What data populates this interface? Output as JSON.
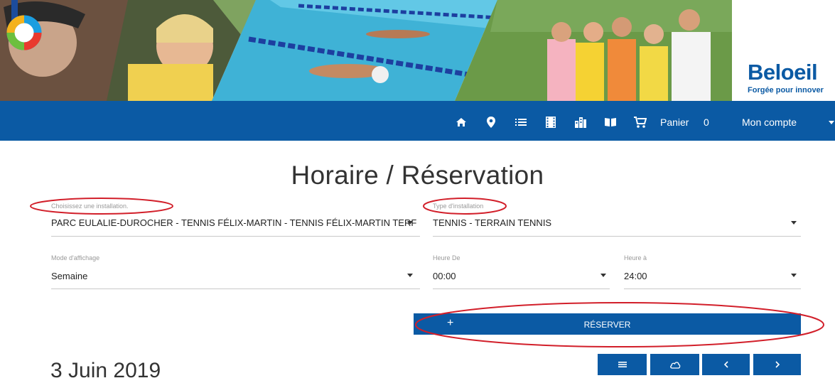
{
  "brand": {
    "name": "Beloeil",
    "tagline": "Forgée pour innover"
  },
  "nav": {
    "cart_label": "Panier",
    "cart_count": "0",
    "account_label": "Mon compte",
    "icons": [
      "home-icon",
      "map-pin-icon",
      "list-icon",
      "film-icon",
      "buildings-icon",
      "book-open-icon",
      "cart-icon"
    ]
  },
  "page": {
    "title": "Horaire / Réservation"
  },
  "form": {
    "installation": {
      "label": "Choisissez une installation.",
      "value": "PARC EULALIE-DUROCHER - TENNIS FÉLIX-MARTIN - TENNIS FÉLIX-MARTIN TERF"
    },
    "type": {
      "label": "Type d'installation",
      "value": "TENNIS - TERRAIN TENNIS"
    },
    "display_mode": {
      "label": "Mode d'affichage",
      "value": "Semaine"
    },
    "hour_from": {
      "label": "Heure De",
      "value": "00:00"
    },
    "hour_to": {
      "label": "Heure à",
      "value": "24:00"
    }
  },
  "reserve": {
    "plus": "+",
    "label": "RÉSERVER"
  },
  "calendar": {
    "date": "3 Juin 2019"
  },
  "colors": {
    "primary": "#0b5aa4",
    "annotation": "#d21f2a"
  }
}
